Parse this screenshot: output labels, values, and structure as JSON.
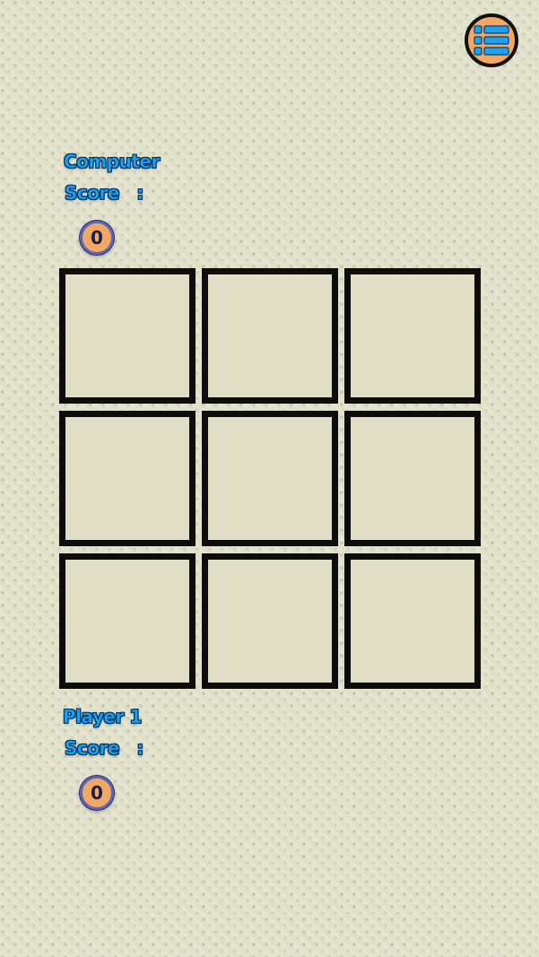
{
  "header": {
    "menu_icon": "list-menu-icon"
  },
  "computer": {
    "name": "Computer",
    "score_label": "Score   :",
    "score": "0"
  },
  "player": {
    "name": "Player 1",
    "score_label": "Score   :",
    "score": "0"
  },
  "board": {
    "cells": [
      "",
      "",
      "",
      "",
      "",
      "",
      "",
      "",
      ""
    ]
  },
  "colors": {
    "accent_orange": "#f2a862",
    "label_blue": "#1ba3f0",
    "board_line": "#0d0d0d",
    "cell_fill": "#e0dfc5"
  }
}
